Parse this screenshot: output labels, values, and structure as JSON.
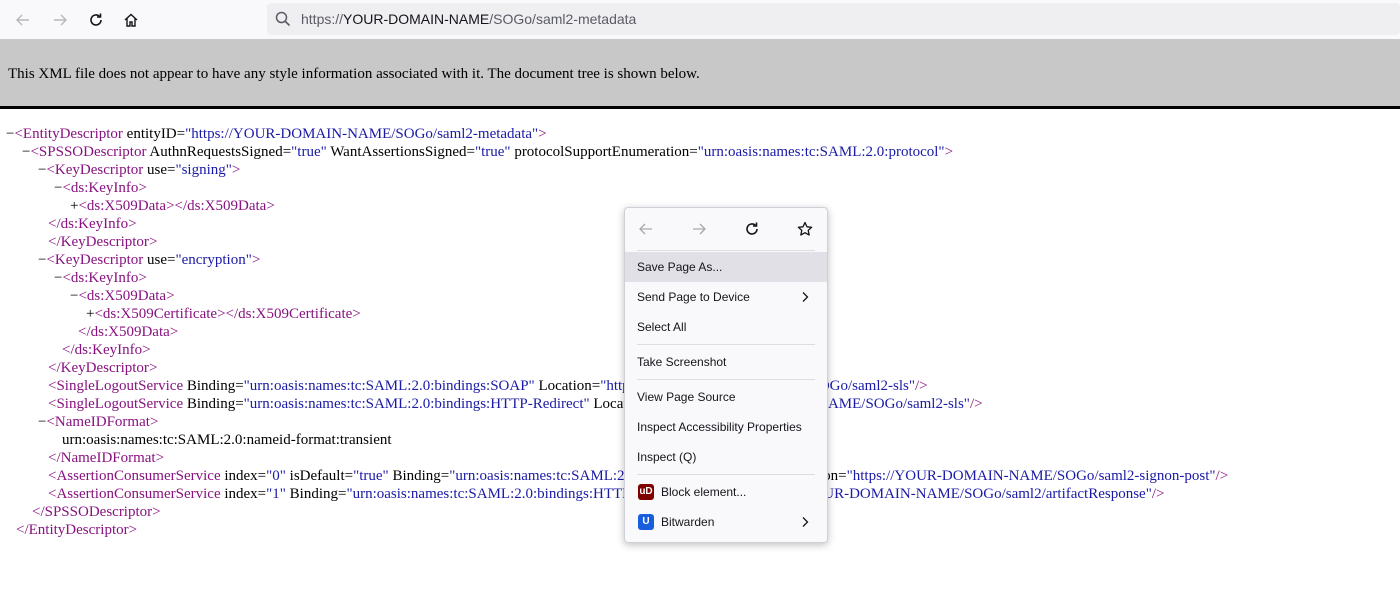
{
  "browser": {
    "url_prefix": "https://",
    "url_domain": "YOUR-DOMAIN-NAME",
    "url_path": "/SOGo/saml2-metadata"
  },
  "xml_viewer": {
    "info_message": "This XML file does not appear to have any style information associated with it. The document tree is shown below.",
    "lines": [
      {
        "fold": "−",
        "tag": "<EntityDescriptor",
        "parts": [
          {
            "attr": " entityID=",
            "val": "\"https://YOUR-DOMAIN-NAME/SOGo/saml2-metadata\""
          }
        ],
        "end": ">"
      },
      {
        "fold": "−",
        "tag": "<SPSSODescriptor",
        "parts": [
          {
            "attr": " AuthnRequestsSigned=",
            "val": "\"true\""
          },
          {
            "attr": " WantAssertionsSigned=",
            "val": "\"true\""
          },
          {
            "attr": " protocolSupportEnumeration=",
            "val": "\"urn:oasis:names:tc:SAML:2.0:protocol\""
          }
        ],
        "end": ">"
      },
      {
        "fold": "−",
        "tag": "<KeyDescriptor",
        "parts": [
          {
            "attr": " use=",
            "val": "\"signing\""
          }
        ],
        "end": ">"
      },
      {
        "fold": "−",
        "tag": "<ds:KeyInfo",
        "parts": [],
        "end": ">"
      },
      {
        "fold": "+",
        "tag": "<ds:X509Data",
        "parts": [],
        "end": "></ds:X509Data>"
      },
      {
        "fold": "",
        "tag": "</ds:KeyInfo",
        "parts": [],
        "end": ">"
      },
      {
        "fold": "",
        "tag": "</KeyDescriptor",
        "parts": [],
        "end": ">"
      },
      {
        "fold": "−",
        "tag": "<KeyDescriptor",
        "parts": [
          {
            "attr": " use=",
            "val": "\"encryption\""
          }
        ],
        "end": ">"
      },
      {
        "fold": "−",
        "tag": "<ds:KeyInfo",
        "parts": [],
        "end": ">"
      },
      {
        "fold": "−",
        "tag": "<ds:X509Data",
        "parts": [],
        "end": ">"
      },
      {
        "fold": "+",
        "tag": "<ds:X509Certificate",
        "parts": [],
        "end": "></ds:X509Certificate>"
      },
      {
        "fold": "",
        "tag": "</ds:X509Data",
        "parts": [],
        "end": ">"
      },
      {
        "fold": "",
        "tag": "</ds:KeyInfo",
        "parts": [],
        "end": ">"
      },
      {
        "fold": "",
        "tag": "</KeyDescriptor",
        "parts": [],
        "end": ">"
      },
      {
        "fold": "",
        "tag": "<SingleLogoutService",
        "parts": [
          {
            "attr": " Binding=",
            "val": "\"urn:oasis:names:tc:SAML:2.0:bindings:SOAP\""
          },
          {
            "attr": " Location=",
            "val": "\"https://YOUR-DOMAIN-NAME/SOGo/saml2-sls\""
          }
        ],
        "end": "/>"
      },
      {
        "fold": "",
        "tag": "<SingleLogoutService",
        "parts": [
          {
            "attr": " Binding=",
            "val": "\"urn:oasis:names:tc:SAML:2.0:bindings:HTTP-Redirect\""
          },
          {
            "attr": " Location=",
            "val": "\"https://YOUR-DOMAIN-NAME/SOGo/saml2-sls\""
          }
        ],
        "end": "/>"
      },
      {
        "fold": "−",
        "tag": "<NameIDFormat",
        "parts": [],
        "end": ">"
      },
      {
        "fold": "",
        "text": "urn:oasis:names:tc:SAML:2.0:nameid-format:transient"
      },
      {
        "fold": "",
        "tag": "</NameIDFormat",
        "parts": [],
        "end": ">"
      },
      {
        "fold": "",
        "tag": "<AssertionConsumerService",
        "parts": [
          {
            "attr": " index=",
            "val": "\"0\""
          },
          {
            "attr": " isDefault=",
            "val": "\"true\""
          },
          {
            "attr": " Binding=",
            "val": "\"urn:oasis:names:tc:SAML:2.0:bindings:HTTP-POST\""
          },
          {
            "attr": " Location=",
            "val": "\"https://YOUR-DOMAIN-NAME/SOGo/saml2-signon-post\""
          }
        ],
        "end": "/>"
      },
      {
        "fold": "",
        "tag": "<AssertionConsumerService",
        "parts": [
          {
            "attr": " index=",
            "val": "\"1\""
          },
          {
            "attr": " Binding=",
            "val": "\"urn:oasis:names:tc:SAML:2.0:bindings:HTTP-Artifact\""
          },
          {
            "attr": " Location=",
            "val": "\"https://YOUR-DOMAIN-NAME/SOGo/saml2/artifactResponse\""
          }
        ],
        "end": "/>"
      },
      {
        "fold": "",
        "tag": "</SPSSODescriptor",
        "parts": [],
        "end": ">"
      },
      {
        "fold": "",
        "tag": "</EntityDescriptor",
        "parts": [],
        "end": ">"
      }
    ]
  },
  "context_menu": {
    "items": {
      "save_page": "Save Page As...",
      "send_page": "Send Page to Device",
      "select_all": "Select All",
      "screenshot": "Take Screenshot",
      "view_source": "View Page Source",
      "inspect_a11y": "Inspect Accessibility Properties",
      "inspect": "Inspect (Q)",
      "block_element": "Block element...",
      "bitwarden": "Bitwarden"
    },
    "ublock_icon_text": "uD",
    "bitwarden_icon_text": "U",
    "colors": {
      "ublock": "#800000",
      "bitwarden": "#175ddc"
    }
  }
}
